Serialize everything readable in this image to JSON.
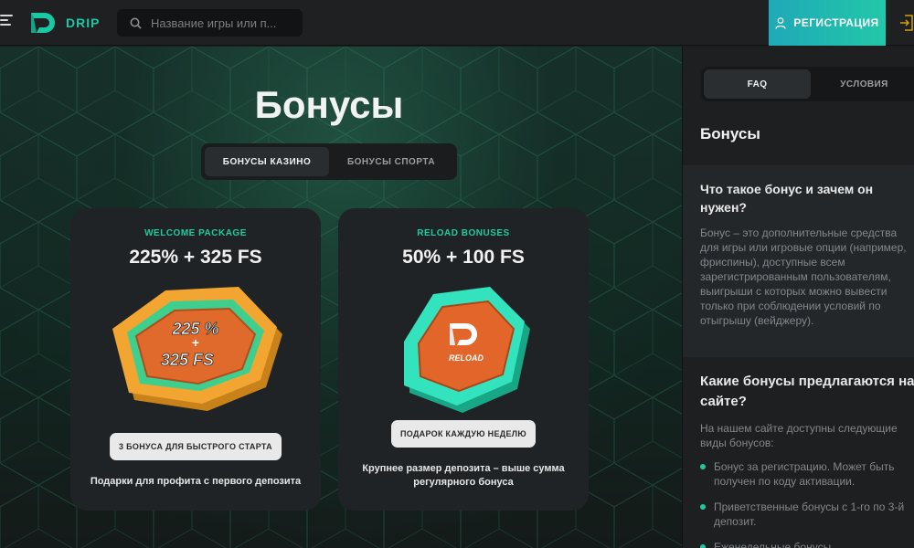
{
  "header": {
    "logo_text": "DRIP",
    "search_placeholder": "Название игры или п...",
    "register_label": "РЕГИСТРАЦИЯ",
    "accent": "#22c7a8"
  },
  "main": {
    "title": "Бонусы",
    "tabs": [
      {
        "label": "БОНУСЫ КАЗИНО",
        "active": true
      },
      {
        "label": "БОНУСЫ СПОРТА",
        "active": false
      }
    ],
    "cards": [
      {
        "label": "WELCOME PACKAGE",
        "amount": "225% + 325 FS",
        "art_text_1": "225 %",
        "art_text_2": "+",
        "art_text_3": "325 FS",
        "chip": "3 БОНУСА ДЛЯ БЫСТРОГО СТАРТА",
        "desc": "Подарки для профита с первого депозита"
      },
      {
        "label": "RELOAD BONUSES",
        "amount": "50% + 100 FS",
        "art_text_1": "RELOAD",
        "chip": "ПОДАРОК КАЖДУЮ НЕДЕЛЮ",
        "desc": "Крупнее размер депозита – выше сумма регулярного бонуса"
      }
    ]
  },
  "sidebar": {
    "tabs": [
      {
        "label": "FAQ",
        "active": true
      },
      {
        "label": "УСЛОВИЯ",
        "active": false
      }
    ],
    "title": "Бонусы",
    "faq": [
      {
        "question": "Что такое бонус и зачем он нужен?",
        "answer": "Бонус – это дополнительные средства для игры или игровые опции (например, фриспины), доступные всем зарегистрированным пользователям, выигрыши с которых можно вывести только при соблюдении условий по отыгрышу (вейджеру)."
      },
      {
        "question": "Какие бонусы предлагаются на сайте?",
        "answer": "На нашем сайте доступны следующие виды бонусов:",
        "items": [
          "Бонус за регистрацию. Может быть получен по коду активации.",
          "Приветственные бонусы с 1-го по 3-й депозит.",
          "Еженедельные бонусы"
        ]
      }
    ]
  }
}
